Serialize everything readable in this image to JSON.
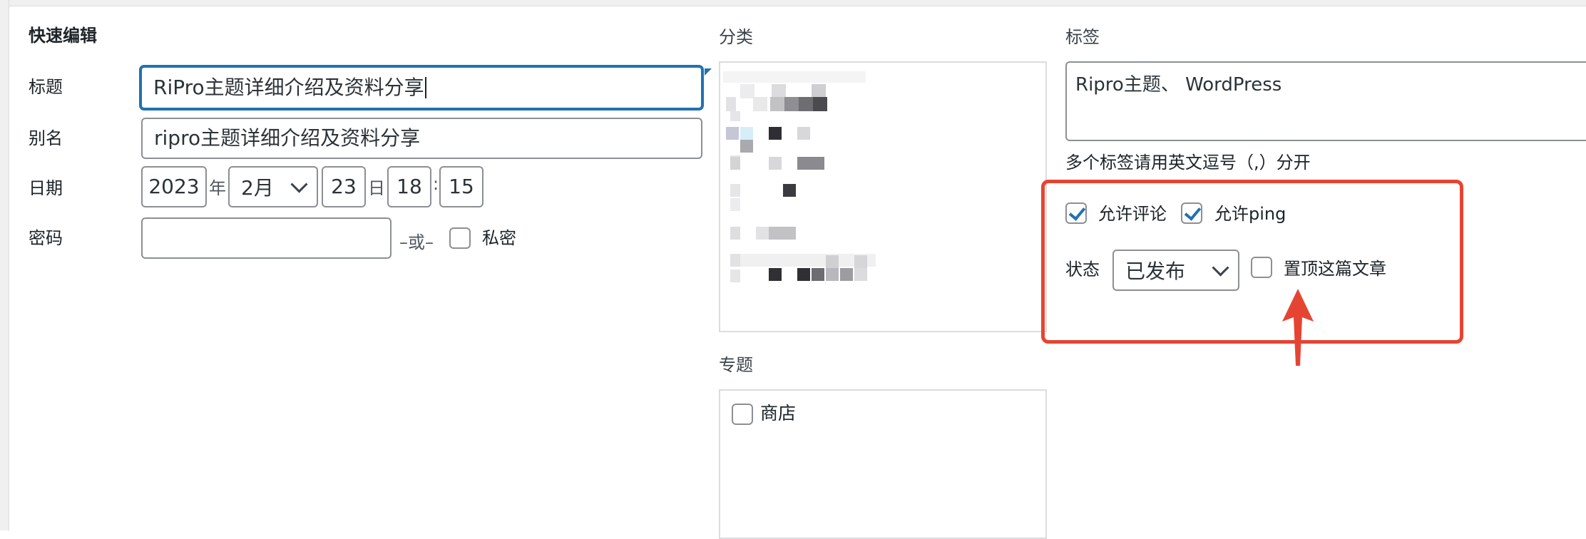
{
  "quick_edit": {
    "heading": "快速编辑",
    "title_label": "标题",
    "title_value": "RiPro主题详细介绍及资料分享",
    "slug_label": "别名",
    "slug_value": "ripro主题详细介绍及资料分享",
    "date_label": "日期",
    "date": {
      "year": "2023",
      "year_unit": "年",
      "month": "2月",
      "day": "23",
      "day_unit": "日",
      "hour": "18",
      "time_sep": ":",
      "minute": "15"
    },
    "password_label": "密码",
    "password_value": "",
    "or_text": "–或–",
    "private_label": "私密"
  },
  "categories": {
    "heading": "分类"
  },
  "topics": {
    "heading": "专题",
    "items": [
      {
        "label": "商店",
        "checked": false
      }
    ]
  },
  "tags": {
    "heading": "标签",
    "value": "Ripro主题、 WordPress",
    "hint": "多个标签请用英文逗号（,）分开"
  },
  "options": {
    "allow_comments": {
      "label": "允许评论",
      "checked": true
    },
    "allow_ping": {
      "label": "允许ping",
      "checked": true
    },
    "status_label": "状态",
    "status_value": "已发布",
    "sticky": {
      "label": "置顶这篇文章",
      "checked": false
    }
  },
  "colors": {
    "focus_blue": "#2271b1",
    "annotation_red": "#e64433",
    "border_gray": "#8c8f94"
  }
}
